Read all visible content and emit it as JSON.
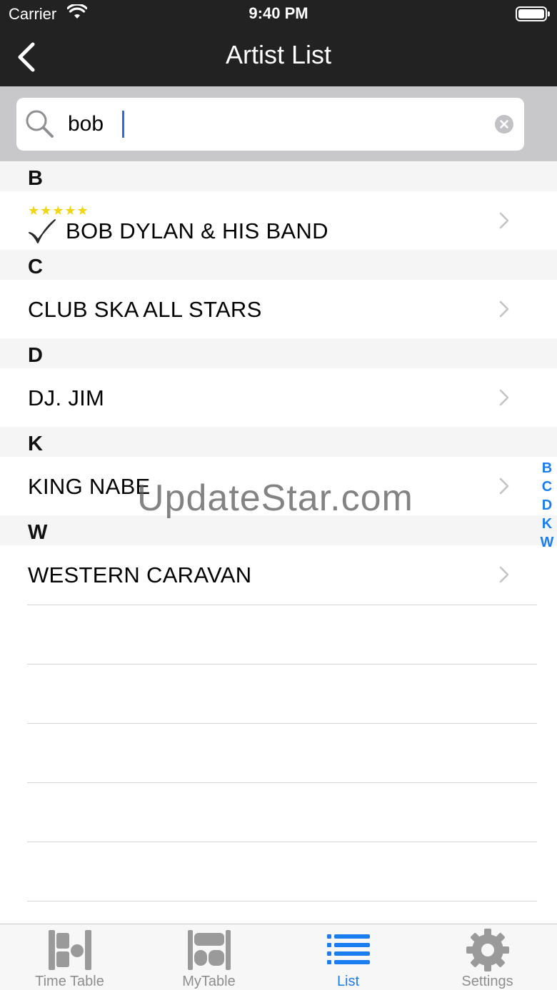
{
  "status_bar": {
    "carrier": "Carrier",
    "time": "9:40 PM"
  },
  "nav": {
    "title": "Artist List"
  },
  "search": {
    "value": "bob"
  },
  "sections": [
    {
      "letter": "B",
      "items": [
        {
          "name": "BOB DYLAN & HIS BAND",
          "stars": "★★★★★",
          "checked": true
        }
      ]
    },
    {
      "letter": "C",
      "items": [
        {
          "name": "CLUB SKA ALL STARS"
        }
      ]
    },
    {
      "letter": "D",
      "items": [
        {
          "name": "DJ. JIM"
        }
      ]
    },
    {
      "letter": "K",
      "items": [
        {
          "name": "KING NABE"
        }
      ]
    },
    {
      "letter": "W",
      "items": [
        {
          "name": "WESTERN CARAVAN"
        }
      ]
    }
  ],
  "index": [
    "B",
    "C",
    "D",
    "K",
    "W"
  ],
  "watermark": "UpdateStar.com",
  "tabs": [
    {
      "label": "Time Table",
      "icon": "timetable-icon"
    },
    {
      "label": "MyTable",
      "icon": "mytable-icon"
    },
    {
      "label": "List",
      "icon": "list-icon",
      "active": true
    },
    {
      "label": "Settings",
      "icon": "gear-icon"
    }
  ],
  "colors": {
    "nav_bg": "#222222",
    "accent": "#1a7ef2",
    "star": "#f2d50e",
    "search_bg": "#c8c8ca"
  }
}
